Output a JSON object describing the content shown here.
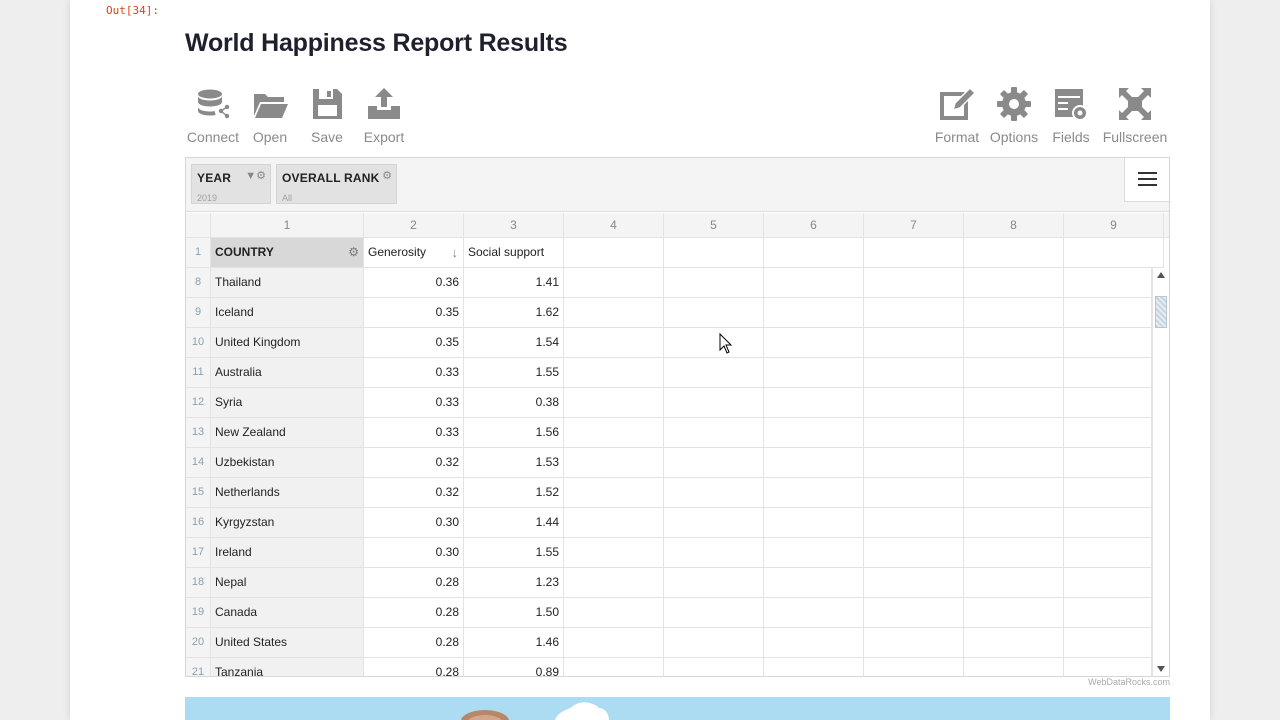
{
  "cell_prompt": "Out[34]:",
  "title": "World Happiness Report Results",
  "toolbar": {
    "connect": "Connect",
    "open": "Open",
    "save": "Save",
    "export": "Export",
    "format": "Format",
    "options": "Options",
    "fields": "Fields",
    "fullscreen": "Fullscreen"
  },
  "filters": [
    {
      "name": "YEAR",
      "value": "2019"
    },
    {
      "name": "OVERALL RANK",
      "value": "All"
    }
  ],
  "column_numbers": [
    "1",
    "2",
    "3",
    "4",
    "5",
    "6",
    "7",
    "8",
    "9"
  ],
  "header_row": {
    "row_number": "1",
    "country": "COUNTRY",
    "generosity": "Generosity",
    "social_support": "Social support"
  },
  "rows": [
    {
      "n": "8",
      "country": "Thailand",
      "generosity": "0.36",
      "social": "1.41"
    },
    {
      "n": "9",
      "country": "Iceland",
      "generosity": "0.35",
      "social": "1.62"
    },
    {
      "n": "10",
      "country": "United Kingdom",
      "generosity": "0.35",
      "social": "1.54"
    },
    {
      "n": "11",
      "country": "Australia",
      "generosity": "0.33",
      "social": "1.55"
    },
    {
      "n": "12",
      "country": "Syria",
      "generosity": "0.33",
      "social": "0.38"
    },
    {
      "n": "13",
      "country": "New Zealand",
      "generosity": "0.33",
      "social": "1.56"
    },
    {
      "n": "14",
      "country": "Uzbekistan",
      "generosity": "0.32",
      "social": "1.53"
    },
    {
      "n": "15",
      "country": "Netherlands",
      "generosity": "0.32",
      "social": "1.52"
    },
    {
      "n": "16",
      "country": "Kyrgyzstan",
      "generosity": "0.30",
      "social": "1.44"
    },
    {
      "n": "17",
      "country": "Ireland",
      "generosity": "0.30",
      "social": "1.55"
    },
    {
      "n": "18",
      "country": "Nepal",
      "generosity": "0.28",
      "social": "1.23"
    },
    {
      "n": "19",
      "country": "Canada",
      "generosity": "0.28",
      "social": "1.50"
    },
    {
      "n": "20",
      "country": "United States",
      "generosity": "0.28",
      "social": "1.46"
    },
    {
      "n": "21",
      "country": "Tanzania",
      "generosity": "0.28",
      "social": "0.89"
    }
  ],
  "credit": "WebDataRocks.com",
  "colors": {
    "accent_icon": "#8a8a8a",
    "prompt": "#d84315",
    "banner": "#abdcf2"
  }
}
